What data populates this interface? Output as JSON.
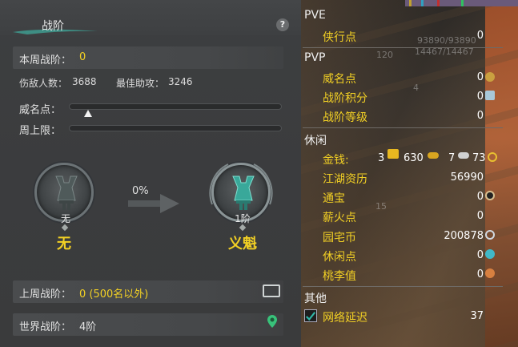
{
  "left_panel": {
    "title": "战阶",
    "help_label": "?",
    "weekly_rank_label": "本周战阶：",
    "weekly_rank_value": "0",
    "kills_label": "伤敌人数：",
    "kills_value": "3688",
    "best_assist_label": "最佳助攻：",
    "best_assist_value": "3246",
    "prestige_label": "威名点：",
    "prestige_progress": 0.09,
    "weekly_cap_label": "周上限：",
    "weekly_cap_progress": 0,
    "current_rank": {
      "caption": "无",
      "name": "无"
    },
    "next_rank": {
      "caption": "1阶",
      "name": "义魁"
    },
    "progress_text": "0%",
    "last_week_label": "上周战阶：",
    "last_week_value": "0 (500名以外)",
    "world_rank_label": "世界战阶：",
    "world_rank_value": "4阶"
  },
  "right_panel": {
    "pve": {
      "title": "PVE",
      "items": [
        {
          "label": "侠行点",
          "value": "0"
        }
      ]
    },
    "pvp": {
      "title": "PVP",
      "items": [
        {
          "label": "威名点",
          "value": "0"
        },
        {
          "label": "战阶积分",
          "value": "0"
        },
        {
          "label": "战阶等级",
          "value": "0"
        }
      ]
    },
    "leisure": {
      "title": "休闲",
      "money_label": "金钱:",
      "money_gold": "3",
      "money_silver": "630",
      "money_copper": "7",
      "money_extra": "73",
      "items": [
        {
          "label": "江湖资历",
          "value": "56990"
        },
        {
          "label": "通宝",
          "value": "0"
        },
        {
          "label": "薪火点",
          "value": "0"
        },
        {
          "label": "园宅币",
          "value": "200878"
        },
        {
          "label": "休闲点",
          "value": "0"
        },
        {
          "label": "桃李值",
          "value": "0"
        }
      ]
    },
    "other": {
      "title": "其他",
      "latency_label": "网络延迟",
      "latency_value": "37"
    },
    "bg_text": {
      "hp": "93890/93890",
      "mp": "14467/14467",
      "level": "120",
      "num15": "15",
      "num4": "4"
    }
  },
  "colors": {
    "accent_yellow": "#f2d024",
    "panel_bg": "#3a3b3c",
    "emblem_teal": "#39a89a"
  }
}
